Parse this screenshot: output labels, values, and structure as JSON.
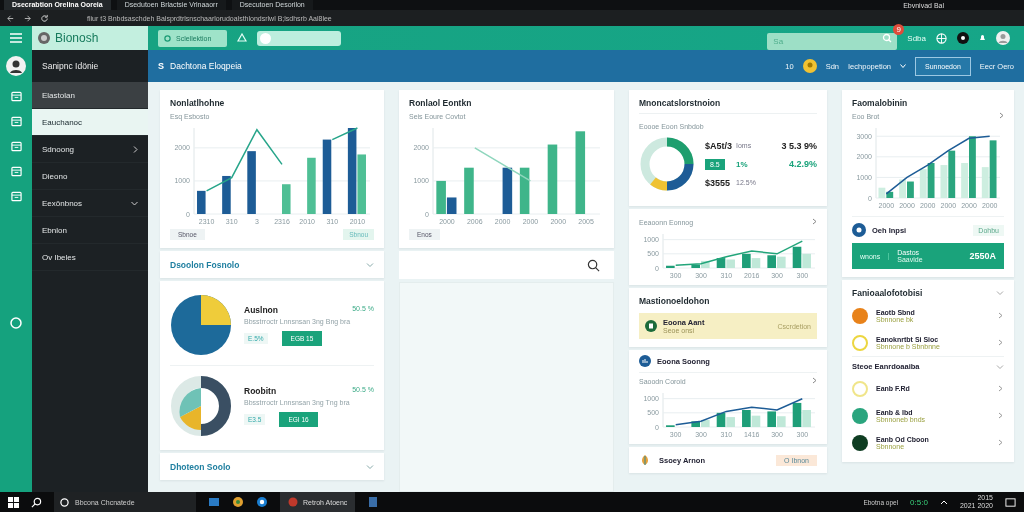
{
  "browser": {
    "tabs": [
      {
        "title": "Dsecrabtion Orelina Ooreia",
        "selected": true
      },
      {
        "title": "Dsedutoen Brlactsie Vrlnaaorr",
        "selected": false
      },
      {
        "title": "Dsecutoen Desorilon",
        "selected": false
      }
    ],
    "address": "fliur t3 Bnbdsaschdeh Balsprdtrlsnschaarlorudoalsthlondsrlwl B;lsdhsrb Aal8lee",
    "extension_label": "Ebvnivad Bal"
  },
  "header": {
    "brand": "Bionosh",
    "action_button": "Sclellektion",
    "toggle": {
      "on": false
    },
    "search": {
      "placeholder": "Sa"
    },
    "notification_count": "9",
    "link": "Sdba"
  },
  "sidebar": {
    "user": "Sanipnc Idönie",
    "items": [
      {
        "label": "Elastolan",
        "selected": false,
        "hovered": true,
        "expandable": false,
        "expanded": false
      },
      {
        "label": "Eauchanoc",
        "selected": true,
        "hovered": false,
        "expandable": false,
        "expanded": false
      },
      {
        "label": "Sdnoong",
        "selected": false,
        "hovered": false,
        "expandable": true,
        "expanded": false
      },
      {
        "label": "Dieono",
        "selected": false,
        "hovered": false,
        "expandable": false,
        "expanded": false
      },
      {
        "label": "Eexönbnos",
        "selected": false,
        "hovered": false,
        "expandable": true,
        "expanded": true
      },
      {
        "label": "Ebnlon",
        "selected": false,
        "hovered": false,
        "expandable": false,
        "expanded": false
      },
      {
        "label": "Ov Ibeles",
        "selected": false,
        "hovered": false,
        "expandable": false,
        "expanded": false
      }
    ]
  },
  "subheader": {
    "icon_letter": "S",
    "title": "Dachtona Eloqpeia",
    "count": "10",
    "user": "Sdn",
    "menu": "Iechpopetion",
    "button": "Sunnoedon",
    "link": "Eecr Oero"
  },
  "overview_card": {
    "title": "Nonlatlhohne",
    "legend": "Esq Esbosto",
    "filter": "Sbnoe",
    "tag": "Sbnou",
    "chart_data": {
      "type": "bar",
      "categories": [
        "2310",
        "310",
        "3",
        "2316",
        "2010",
        "310",
        "2010"
      ],
      "yticks": [
        0,
        1000,
        2000
      ],
      "ylim": [
        0,
        2600
      ],
      "grid": true,
      "series": [
        {
          "color": "#1d5c96",
          "values": [
            700,
            1150,
            1900,
            null,
            null,
            2250,
            2600
          ]
        },
        {
          "color": "#4fbf95",
          "values": [
            null,
            null,
            null,
            900,
            1700,
            null,
            1800
          ]
        },
        {
          "color": "#27a58a",
          "type": "line",
          "values": [
            700,
            1100,
            2550,
            1500,
            null,
            2250,
            2600
          ]
        }
      ]
    }
  },
  "section_1": {
    "title": "Dsoolon Fosnolo",
    "expanded": false
  },
  "breakdowns": [
    {
      "kind": "pie",
      "title": "Auslnon",
      "share": "50.5 %",
      "note": "Bbsstrroctr Lnnsnsan 3ng Bng bra",
      "chip": "E.5%",
      "button": "EGB 15"
    },
    {
      "kind": "donut",
      "title": "Roobitn",
      "share": "50.5 %",
      "note": "Bbsstrroctr Lnnsnsan 3ng Tng bra",
      "chip": "E3.5",
      "button": "EGI 16"
    }
  ],
  "section_2": {
    "title": "Dhoteon Soolo",
    "expanded": false
  },
  "revenue_card": {
    "title": "Ronlaol Eontkn",
    "legend": "Seis Eoure Covtot",
    "button": "Enos",
    "chart_data": {
      "type": "bar",
      "categories": [
        "2000",
        "2006",
        "2000",
        "2000",
        "2000",
        "2005"
      ],
      "yticks": [
        0,
        1000,
        2000
      ],
      "ylim": [
        0,
        2600
      ],
      "grid": true,
      "series": [
        {
          "color": "#3fb58a",
          "values": [
            1000,
            1400,
            null,
            1400,
            2100,
            2500
          ]
        },
        {
          "color": "#1d5c96",
          "values": [
            500,
            null,
            1400,
            null,
            null,
            null
          ]
        },
        {
          "color": "#8fd6bd",
          "type": "line",
          "values": [
            null,
            2000,
            1500,
            1000,
            null,
            null
          ]
        }
      ]
    }
  },
  "summary_card": {
    "title": "Mnoncatslorstnoion",
    "subtitle": "Eoooe Eoon Snbdob",
    "amount": "$A5t/3",
    "amount_label": "Ioms",
    "change": "3 5.3 9%",
    "badge": "8.5",
    "badge_suffix": "1%",
    "growth": "4.2.9%",
    "total": "$3555",
    "total_change": "12.5%"
  },
  "trend_card": {
    "chart_data": {
      "type": "bar",
      "title": "Eeaoonn Eonnog",
      "categories": [
        "300",
        "300",
        "310",
        "2016",
        "300",
        "300"
      ],
      "yticks": [
        0,
        500,
        1000
      ],
      "ylim": [
        0,
        1200
      ],
      "grid": true,
      "series": [
        {
          "color": "#1e9e78",
          "values": [
            80,
            120,
            350,
            500,
            450,
            750
          ]
        },
        {
          "color": "#bfe8d8",
          "values": [
            null,
            250,
            300,
            350,
            400,
            500
          ]
        },
        {
          "color": "#22a57a",
          "type": "line",
          "values": [
            100,
            150,
            400,
            600,
            500,
            950
          ]
        }
      ]
    }
  },
  "alerts_card": {
    "title": "Mastionoeldohon",
    "alert": {
      "title": "Eoona Aant",
      "subtitle": "Seoe onsi",
      "action": "Cscrdetion"
    }
  },
  "activity_card": {
    "title": "Eoona Soonng",
    "chart_data": {
      "type": "bar",
      "title": "Saoodn Coroid",
      "categories": [
        "300",
        "300",
        "310",
        "1416",
        "300",
        "300"
      ],
      "yticks": [
        0,
        500,
        1000
      ],
      "ylim": [
        0,
        1200
      ],
      "grid": true,
      "series": [
        {
          "color": "#1e9e78",
          "values": [
            60,
            200,
            500,
            600,
            550,
            850
          ]
        },
        {
          "color": "#bfe8d8",
          "values": [
            null,
            250,
            350,
            400,
            380,
            600
          ]
        },
        {
          "color": "#1d5c96",
          "type": "line",
          "values": [
            80,
            200,
            550,
            700,
            600,
            1000
          ]
        }
      ]
    }
  },
  "tasks_card": {
    "title": "Ssoey Arnon",
    "chip": "O Ibnon"
  },
  "performance_card": {
    "title": "Faomalobinin",
    "legend": "Eoo Brot",
    "owner": "Oeh Inpsi",
    "owner_link": "Dohbu",
    "banner": {
      "label": "wnons",
      "title": "Dastos",
      "subtitle": "Saavide",
      "value": "2550A"
    },
    "chart_data": {
      "type": "bar",
      "categories": [
        "2000",
        "2000",
        "2000",
        "2000",
        "2000",
        "2000"
      ],
      "yticks": [
        0,
        1000,
        2000,
        3000
      ],
      "ylim": [
        0,
        3400
      ],
      "grid": true,
      "series": [
        {
          "color": "#cdeee0",
          "values": [
            500,
            900,
            1400,
            1600,
            1700,
            1500
          ]
        },
        {
          "color": "#2aa57e",
          "values": [
            300,
            800,
            1700,
            2300,
            3000,
            2800
          ]
        },
        {
          "color": "#1d5c96",
          "type": "line",
          "values": [
            200,
            1000,
            1600,
            2300,
            2900,
            3000
          ]
        }
      ]
    }
  },
  "contacts_card": {
    "title": "Fanioaalofotobisi",
    "items": [
      {
        "kind": "filled",
        "name": "Eaotb Sbnd",
        "detail": "Sbnnone bk",
        "color": "#e8821a"
      },
      {
        "kind": "ring",
        "name": "Eanoknrtbt Si Sioc",
        "detail": "Sbnnone b Sbnbnne",
        "color": "#ecd640"
      }
    ],
    "group": {
      "title": "Steoe Eanrdoaaiba",
      "items": [
        {
          "kind": "ring",
          "name": "Eanb F.Rd",
          "color": "#f0e58a"
        },
        {
          "kind": "filled",
          "name": "Eanb & Ibd",
          "detail": "Sbnnoneb bnds",
          "color": "#2aa57e"
        },
        {
          "kind": "filled",
          "name": "Eanb Od Cboon",
          "detail": "Sbnnone",
          "color": "#0f3d22"
        }
      ]
    }
  },
  "taskbar": {
    "search": "Bbcona Chcnatede",
    "app": "Retroh Atoenc",
    "tray_label": "Ebotna opel",
    "timer": "0:5:0",
    "time": "2015",
    "date": "2021 2020"
  }
}
